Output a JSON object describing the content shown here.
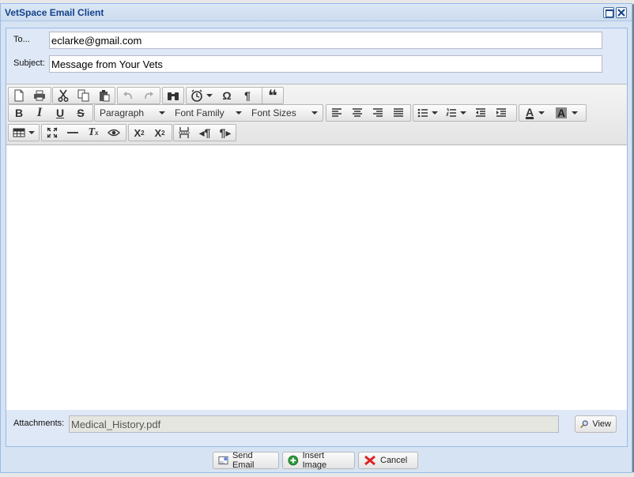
{
  "window": {
    "title": "VetSpace Email Client"
  },
  "form": {
    "to_label": "To...",
    "to_value": "eclarke@gmail.com",
    "subject_label": "Subject:",
    "subject_value": "Message from Your Vets",
    "attachments_label": "Attachments:",
    "attachments_value": "Medical_History.pdf",
    "view_label": "View"
  },
  "toolbar": {
    "row1": [
      "new-document-icon",
      "print-icon",
      "cut-icon",
      "copy-icon",
      "paste-icon",
      "undo-icon",
      "redo-icon",
      "find-icon",
      "insert-time-icon",
      "special-character-icon",
      "show-blocks-icon",
      "blockquote-icon"
    ],
    "format_label": "Paragraph",
    "font_family_label": "Font Family",
    "font_size_label": "Font Sizes",
    "row2": [
      "bold-icon",
      "italic-icon",
      "underline-icon",
      "strikethrough-icon",
      "align-left-icon",
      "align-center-icon",
      "align-right-icon",
      "justify-icon",
      "bullet-list-icon",
      "numbered-list-icon",
      "outdent-icon",
      "indent-icon",
      "text-color-icon",
      "background-color-icon"
    ],
    "row3": [
      "table-icon",
      "fullscreen-icon",
      "horizontal-rule-icon",
      "remove-format-icon",
      "preview-icon",
      "subscript-icon",
      "superscript-icon",
      "page-break-icon",
      "ltr-icon",
      "rtl-icon"
    ]
  },
  "footer": {
    "send_label": "Send Email",
    "insert_label": "Insert Image",
    "cancel_label": "Cancel"
  },
  "colors": {
    "title_text": "#15428b",
    "window_bg": "#d6e3f2",
    "panel_border": "#99bbe8"
  }
}
